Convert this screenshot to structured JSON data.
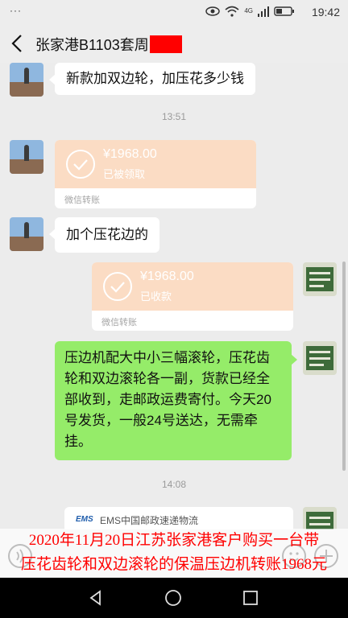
{
  "status_bar": {
    "dots": "···",
    "time": "19:42",
    "network_label": "4G"
  },
  "nav": {
    "title": "张家港B1103套周"
  },
  "messages": {
    "m1_text": "新款加双边轮，加压花多少钱",
    "time1": "13:51",
    "transfer1": {
      "amount": "¥1968.00",
      "status": "已被领取",
      "footer": "微信转账"
    },
    "m2_text": "加个压花边的",
    "transfer2": {
      "amount": "¥1968.00",
      "status": "已收款",
      "footer": "微信转账"
    },
    "m3_text": "压边机配大中小三幅滚轮，压花齿轮和双边滚轮各一副，货款已经全部收到，走邮政运费寄付。今天20号发货，一般24号送达，无需牵挂。",
    "time2": "14:08",
    "ems_name": "EMS中国邮政速递物流",
    "ems_logo": "EMS"
  },
  "caption": {
    "line1": "2020年11月20日江苏张家港客户购买一台带",
    "line2": "压花齿轮和双边滚轮的保温压边机转账1968元"
  },
  "colors": {
    "green_bubble": "#95ec69",
    "transfer_orange": "#fbdcc4",
    "caption_red": "#ff0000",
    "redaction": "#ff0000"
  }
}
